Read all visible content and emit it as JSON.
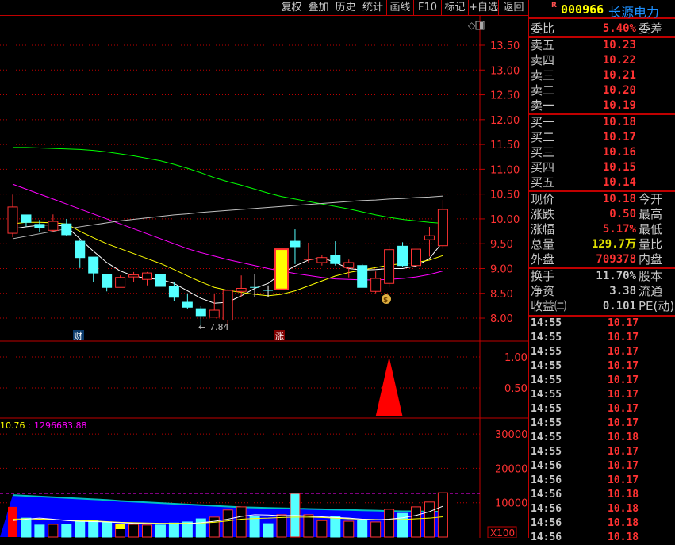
{
  "toolbar": [
    "复权",
    "叠加",
    "历史",
    "统计",
    "画线",
    "F10",
    "标记",
    "+自选",
    "返回"
  ],
  "quote": {
    "badge": "R",
    "code": "000966",
    "name": "长源电力",
    "wei": {
      "label": "委比",
      "value": "5.40%",
      "right": "委差"
    },
    "asks": [
      {
        "label": "卖五",
        "price": "10.23"
      },
      {
        "label": "卖四",
        "price": "10.22"
      },
      {
        "label": "卖三",
        "price": "10.21"
      },
      {
        "label": "卖二",
        "price": "10.20"
      },
      {
        "label": "卖一",
        "price": "10.19"
      }
    ],
    "bids": [
      {
        "label": "买一",
        "price": "10.18"
      },
      {
        "label": "买二",
        "price": "10.17"
      },
      {
        "label": "买三",
        "price": "10.16"
      },
      {
        "label": "买四",
        "price": "10.15"
      },
      {
        "label": "买五",
        "price": "10.14"
      }
    ],
    "stats": [
      {
        "label": "现价",
        "value": "10.18",
        "right": "今开",
        "color": "#ff3232"
      },
      {
        "label": "涨跌",
        "value": "0.50",
        "right": "最高",
        "color": "#ff3232"
      },
      {
        "label": "涨幅",
        "value": "5.17%",
        "right": "最低",
        "color": "#ff3232"
      },
      {
        "label": "总量",
        "value": "129.7万",
        "right": "量比",
        "color": "#e0e000"
      },
      {
        "label": "外盘",
        "value": "709378",
        "right": "内盘",
        "color": "#ff3232"
      }
    ],
    "fund": [
      {
        "label": "换手",
        "value": "11.70%",
        "right": "股本"
      },
      {
        "label": "净资",
        "value": "3.38",
        "right": "流通"
      },
      {
        "label": "收益㈡",
        "value": "0.101",
        "right": "PE(动)"
      }
    ]
  },
  "ticks": [
    {
      "t": "14:55",
      "p": "10.17",
      "m": "1"
    },
    {
      "t": "14:55",
      "p": "10.17"
    },
    {
      "t": "14:55",
      "p": "10.17"
    },
    {
      "t": "14:55",
      "p": "10.17"
    },
    {
      "t": "14:55",
      "p": "10.17"
    },
    {
      "t": "14:55",
      "p": "10.17"
    },
    {
      "t": "14:55",
      "p": "10.17"
    },
    {
      "t": "14:55",
      "p": "10.17"
    },
    {
      "t": "14:55",
      "p": "10.18"
    },
    {
      "t": "14:55",
      "p": "10.17"
    },
    {
      "t": "14:56",
      "p": "10.17"
    },
    {
      "t": "14:56",
      "p": "10.17",
      "m": "1"
    },
    {
      "t": "14:56",
      "p": "10.18"
    },
    {
      "t": "14:56",
      "p": "10.18"
    },
    {
      "t": "14:56",
      "p": "10.18"
    },
    {
      "t": "14:56",
      "p": "10.18"
    }
  ],
  "chart_data": {
    "type": "candlestick",
    "price_axis": {
      "ticks": [
        "13.50",
        "13.00",
        "12.50",
        "12.00",
        "11.50",
        "11.00",
        "10.50",
        "10.00",
        "9.50",
        "9.00",
        "8.50",
        "8.00"
      ],
      "range": [
        8.0,
        13.5
      ]
    },
    "low_label": "7.84",
    "markers": {
      "cai": "财",
      "zhang": "涨"
    },
    "candles": [
      [
        9.71,
        10.24,
        10.49,
        9.63
      ],
      [
        10.08,
        9.93,
        10.08,
        9.85
      ],
      [
        9.89,
        9.82,
        9.98,
        9.74
      ],
      [
        9.77,
        9.95,
        10.09,
        9.73
      ],
      [
        9.9,
        9.68,
        10.0,
        9.66
      ],
      [
        9.55,
        9.22,
        9.57,
        9.01
      ],
      [
        9.23,
        8.91,
        9.23,
        8.72
      ],
      [
        8.88,
        8.62,
        8.88,
        8.54
      ],
      [
        8.62,
        8.82,
        8.86,
        8.62
      ],
      [
        8.83,
        8.87,
        8.93,
        8.72
      ],
      [
        8.78,
        8.91,
        8.93,
        8.66
      ],
      [
        8.88,
        8.64,
        8.88,
        8.64
      ],
      [
        8.64,
        8.42,
        8.72,
        8.35
      ],
      [
        8.32,
        8.22,
        8.5,
        8.18
      ],
      [
        8.19,
        8.05,
        8.24,
        7.84
      ],
      [
        8.02,
        8.16,
        8.5,
        8.02
      ],
      [
        7.96,
        8.56,
        8.58,
        7.86
      ],
      [
        8.54,
        8.6,
        8.86,
        8.42
      ],
      [
        8.62,
        8.61,
        8.88,
        8.42
      ],
      [
        8.56,
        8.55,
        8.66,
        8.42
      ],
      [
        8.58,
        9.39,
        9.39,
        8.58
      ],
      [
        9.55,
        9.44,
        9.79,
        9.09
      ],
      [
        9.18,
        9.18,
        9.52,
        9.11
      ],
      [
        9.12,
        9.22,
        9.27,
        9.06
      ],
      [
        9.26,
        9.1,
        9.55,
        9.06
      ],
      [
        9.02,
        9.12,
        9.18,
        8.82
      ],
      [
        9.06,
        8.62,
        9.09,
        8.62
      ],
      [
        8.54,
        8.8,
        8.94,
        8.5
      ],
      [
        8.7,
        9.38,
        9.46,
        8.62
      ],
      [
        9.45,
        9.06,
        9.53,
        9.03
      ],
      [
        9.06,
        9.39,
        9.49,
        8.98
      ],
      [
        9.58,
        9.66,
        9.84,
        9.24
      ],
      [
        9.46,
        10.19,
        10.38,
        9.4
      ]
    ],
    "limit_up_index": 20,
    "ma": [
      {
        "color": "#ffffff",
        "values": [
          9.8,
          9.84,
          9.87,
          9.88,
          9.85,
          9.6,
          9.35,
          9.12,
          8.95,
          8.85,
          8.8,
          8.78,
          8.7,
          8.55,
          8.4,
          8.3,
          8.32,
          8.45,
          8.6,
          8.7,
          8.9,
          9.05,
          9.17,
          9.22,
          9.12,
          9.0,
          8.97,
          8.98,
          9.0,
          9.0,
          9.05,
          9.2,
          9.54
        ]
      },
      {
        "color": "#ffff00",
        "values": [
          9.9,
          9.93,
          9.93,
          9.92,
          9.9,
          9.75,
          9.62,
          9.5,
          9.4,
          9.3,
          9.2,
          9.1,
          8.98,
          8.85,
          8.73,
          8.62,
          8.56,
          8.52,
          8.48,
          8.45,
          8.48,
          8.55,
          8.65,
          8.75,
          8.85,
          8.92,
          8.97,
          9.02,
          9.07,
          9.1,
          9.12,
          9.17,
          9.26
        ]
      },
      {
        "color": "#ff00ff",
        "values": [
          10.7,
          10.6,
          10.5,
          10.4,
          10.3,
          10.2,
          10.1,
          10.0,
          9.9,
          9.8,
          9.7,
          9.6,
          9.5,
          9.4,
          9.32,
          9.25,
          9.18,
          9.12,
          9.06,
          9.0,
          8.95,
          8.9,
          8.86,
          8.82,
          8.79,
          8.78,
          8.77,
          8.77,
          8.78,
          8.8,
          8.83,
          8.88,
          8.95
        ]
      },
      {
        "color": "#00ff00",
        "values": [
          11.44,
          11.44,
          11.43,
          11.42,
          11.41,
          11.4,
          11.38,
          11.35,
          11.31,
          11.27,
          11.22,
          11.17,
          11.1,
          11.02,
          10.93,
          10.83,
          10.75,
          10.68,
          10.6,
          10.52,
          10.45,
          10.4,
          10.35,
          10.3,
          10.25,
          10.2,
          10.14,
          10.08,
          10.03,
          9.99,
          9.96,
          9.93,
          9.91
        ]
      },
      {
        "color": "#c0c0c0",
        "values": [
          9.6,
          9.65,
          9.7,
          9.75,
          9.8,
          9.84,
          9.88,
          9.92,
          9.96,
          9.99,
          10.02,
          10.05,
          10.08,
          10.1,
          10.13,
          10.15,
          10.17,
          10.19,
          10.21,
          10.23,
          10.25,
          10.27,
          10.29,
          10.31,
          10.33,
          10.35,
          10.37,
          10.38,
          10.4,
          10.41,
          10.43,
          10.44,
          10.46
        ]
      }
    ],
    "signal": {
      "axis_ticks": [
        "1.00",
        "0.50"
      ],
      "index": 28,
      "value": 1.0
    },
    "volume": {
      "axis_ticks": [
        "30000",
        "20000",
        "10000"
      ],
      "unit": "X100",
      "header_a": "10.76",
      "header_sep": ":",
      "header_b": "1296683.88",
      "ref_line": 12700,
      "values": [
        8800,
        5500,
        3500,
        3700,
        3700,
        4800,
        4800,
        4400,
        3700,
        3700,
        3500,
        3500,
        4100,
        4400,
        5300,
        5800,
        7900,
        8800,
        6000,
        3900,
        6500,
        12700,
        6500,
        4800,
        6000,
        4600,
        4800,
        4400,
        8100,
        6900,
        8800,
        10200,
        12900
      ],
      "area": [
        12200,
        12000,
        11800,
        11600,
        11400,
        11200,
        11000,
        10800,
        10500,
        10300,
        10100,
        9900,
        9700,
        9500,
        9300,
        9100,
        8900,
        8700,
        8600,
        8500,
        8400,
        8300,
        8200,
        8100,
        8000,
        7900,
        7800,
        7700,
        7600,
        7500,
        7500,
        7400,
        7400
      ],
      "ma_white": [
        4800,
        5200,
        5500,
        5200,
        4800,
        4600,
        4500,
        4400,
        4200,
        4000,
        3900,
        3900,
        3800,
        3900,
        4200,
        4600,
        5200,
        6000,
        6500,
        6400,
        6200,
        6300,
        6100,
        5900,
        5700,
        5500,
        5200,
        5000,
        5200,
        5600,
        6300,
        7400,
        9000
      ],
      "ma_yellow": [
        5200,
        5300,
        5200,
        5100,
        4900,
        4800,
        4700,
        4500,
        4300,
        4200,
        4100,
        4000,
        4000,
        4000,
        4100,
        4300,
        4700,
        5200,
        5400,
        5500,
        5700,
        5800,
        5800,
        5700,
        5500,
        5300,
        5200,
        5100,
        5000,
        5100,
        5300,
        5500,
        5900
      ]
    },
    "colors": {
      "up": "#ff3232",
      "down": "#54ffff",
      "grid": "#c00000"
    }
  }
}
